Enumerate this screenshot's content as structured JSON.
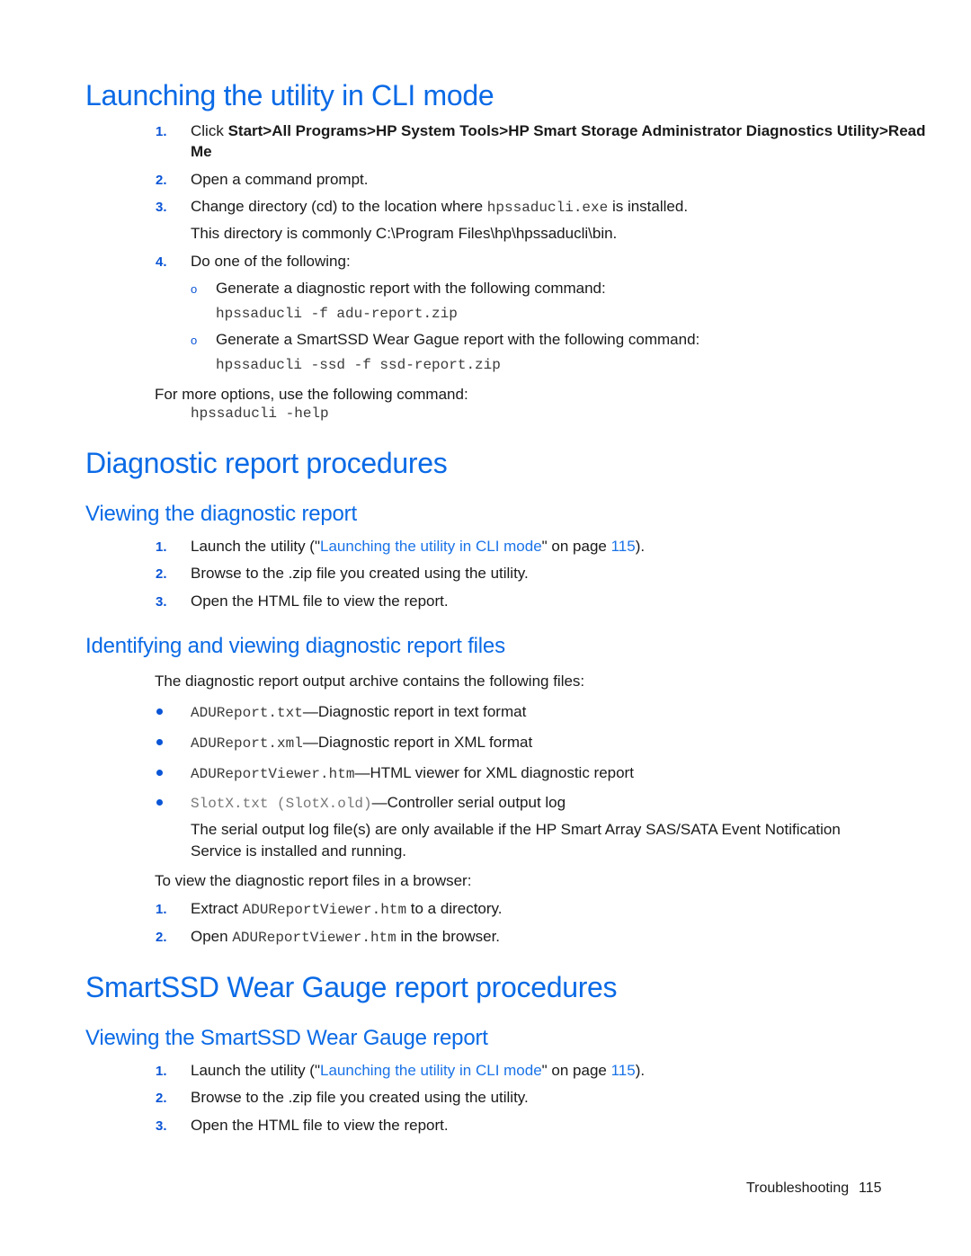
{
  "colors": {
    "heading": "#0a6ae6",
    "list_number": "#0a55d6",
    "link": "#1a73e8",
    "text": "#1a1a1a"
  },
  "section1": {
    "title": "Launching the utility in CLI mode",
    "steps": [
      {
        "num": "1.",
        "prefix": "Click ",
        "bold": "Start>All Programs>HP System Tools>HP Smart Storage Administrator Diagnostics Utility>Read",
        "bold_cont": "Me"
      },
      {
        "num": "2.",
        "text": "Open a command prompt."
      },
      {
        "num": "3.",
        "prefix": "Change directory (cd) to the location where ",
        "code": "hpssaducli.exe",
        "suffix": " is installed.",
        "note": "This directory is commonly C:\\Program Files\\hp\\hpssaducli\\bin."
      },
      {
        "num": "4.",
        "text": "Do one of the following:"
      }
    ],
    "substeps": [
      {
        "bullet": "o",
        "text": "Generate a diagnostic report with the following command:",
        "code": "hpssaducli -f adu-report.zip"
      },
      {
        "bullet": "o",
        "text": "Generate a SmartSSD Wear Gague report with the following command:",
        "code": "hpssaducli -ssd -f ssd-report.zip"
      }
    ],
    "more_options": "For more options, use the following command:",
    "more_code": "hpssaducli -help"
  },
  "section2": {
    "title": "Diagnostic report procedures",
    "sub1": {
      "title": "Viewing the diagnostic report",
      "steps": [
        {
          "num": "1.",
          "prefix": "Launch the utility (\"",
          "link": "Launching the utility in CLI mode",
          "mid": "\" on page ",
          "page": "115",
          "suffix": ")."
        },
        {
          "num": "2.",
          "text": "Browse to the .zip file you created using the utility."
        },
        {
          "num": "3.",
          "text": "Open the HTML file to view the report."
        }
      ]
    },
    "sub2": {
      "title": "Identifying and viewing diagnostic report files",
      "intro": "The diagnostic report output archive contains the following files:",
      "files": [
        {
          "code": "ADUReport.txt",
          "desc": "—Diagnostic report in text format"
        },
        {
          "code": "ADUReport.xml",
          "desc": "—Diagnostic report in XML format"
        },
        {
          "code": "ADUReportViewer.htm",
          "desc": "—HTML viewer for XML diagnostic report"
        },
        {
          "code": "SlotX.txt (SlotX.old)",
          "desc": "—Controller serial output log"
        }
      ],
      "serial_note_line1": "The serial output log file(s) are only available if the HP Smart Array SAS/SATA Event Notification",
      "serial_note_line2": "Service is installed and running.",
      "browser_intro": "To view the diagnostic report files in a browser:",
      "browser_steps": [
        {
          "num": "1.",
          "prefix": "Extract ",
          "code": "ADUReportViewer.htm",
          "suffix": " to a directory."
        },
        {
          "num": "2.",
          "prefix": "Open ",
          "code": "ADUReportViewer.htm",
          "suffix": " in the browser."
        }
      ]
    }
  },
  "section3": {
    "title": "SmartSSD Wear Gauge report procedures",
    "sub1": {
      "title": "Viewing the SmartSSD Wear Gauge report",
      "steps": [
        {
          "num": "1.",
          "prefix": "Launch the utility (\"",
          "link": "Launching the utility in CLI mode",
          "mid": "\" on page ",
          "page": "115",
          "suffix": ")."
        },
        {
          "num": "2.",
          "text": "Browse to the .zip file you created using the utility."
        },
        {
          "num": "3.",
          "text": "Open the HTML file to view the report."
        }
      ]
    }
  },
  "footer": {
    "section": "Troubleshooting",
    "page": "115"
  }
}
